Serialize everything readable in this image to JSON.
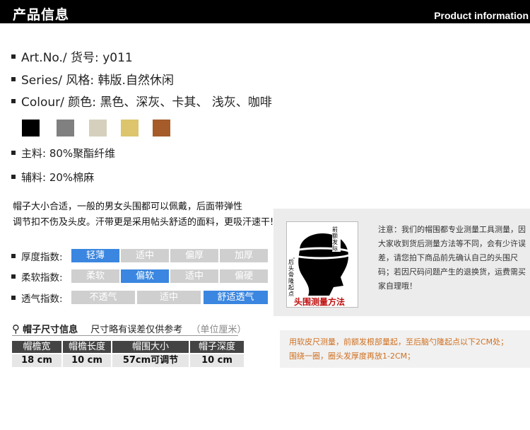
{
  "header": {
    "title_cn": "产品信息",
    "title_en": "Product information"
  },
  "specs": [
    {
      "label": "Art.No./ 货号:",
      "value": "y011"
    },
    {
      "label": "Series/ 风格:",
      "value": "韩版.自然休闲"
    },
    {
      "label": "Colour/ 颜色:",
      "value": "黑色、深灰、卡其、 浅灰、咖啡"
    }
  ],
  "swatches": [
    "#000000",
    "#808080",
    "#d5d0bd",
    "#dcc56c",
    "#a65c2a"
  ],
  "materials": [
    {
      "label": "主料:",
      "value": "80%聚酯纤维"
    },
    {
      "label": "辅料:",
      "value": "20%棉麻"
    }
  ],
  "description": [
    "帽子大小合适，一般的男女头围都可以佩戴，后面带弹性",
    "调节扣不伤及头皮。汗带更是采用帖头舒适的面料，更吸汗速干!"
  ],
  "indices": [
    {
      "label": "厚度指数:",
      "options": [
        "轻薄",
        "适中",
        "偏厚",
        "加厚"
      ],
      "selected": 0
    },
    {
      "label": "柔软指数:",
      "options": [
        "柔软",
        "偏软",
        "适中",
        "偏硬"
      ],
      "selected": 1
    },
    {
      "label": "透气指数:",
      "options": [
        "不透气",
        "适中",
        "舒适透气"
      ],
      "selected": 2
    }
  ],
  "measure": {
    "note": "注意：我们的帽围都专业测量工具测量，因大家收到货后测量方法等不同，会有少许误差，请您拍下商品前先确认自己的头围尺码；若因尺码问题产生的退换货，运费需买家自理哦！",
    "image_caption": "头围测量方法",
    "image_label_top": "前额发际",
    "image_label_side": "后头骨隆起点"
  },
  "size": {
    "title": "帽子尺寸信息",
    "subtitle": "尺寸略有误差仅供参考",
    "unit": "（单位厘米）",
    "headers": [
      "帽檐宽",
      "帽檐长度",
      "帽围大小",
      "帽子深度"
    ],
    "values": [
      "18 cm",
      "10 cm",
      "57cm可调节",
      "10 cm"
    ]
  },
  "tip": [
    "用软皮尺测量，前额发根部量起，至后脑勺隆起点以下2CM处；",
    "围绕一圈，圈头发厚度再放1-2CM；"
  ]
}
